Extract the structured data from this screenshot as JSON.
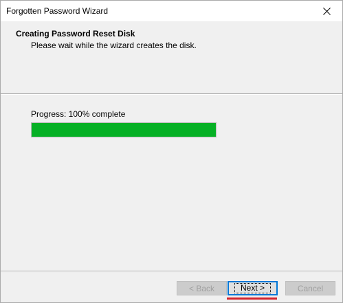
{
  "window": {
    "title": "Forgotten Password Wizard"
  },
  "header": {
    "title": "Creating Password Reset Disk",
    "subtitle": "Please wait while the wizard creates the disk."
  },
  "progress": {
    "label": "Progress: 100% complete",
    "percent": 100,
    "fill_color": "#06b025"
  },
  "buttons": {
    "back": "< Back",
    "next": "Next >",
    "cancel": "Cancel"
  },
  "colors": {
    "accent": "#0078d7",
    "annotation": "#d4222b"
  },
  "icons": {
    "close": "close-icon"
  }
}
